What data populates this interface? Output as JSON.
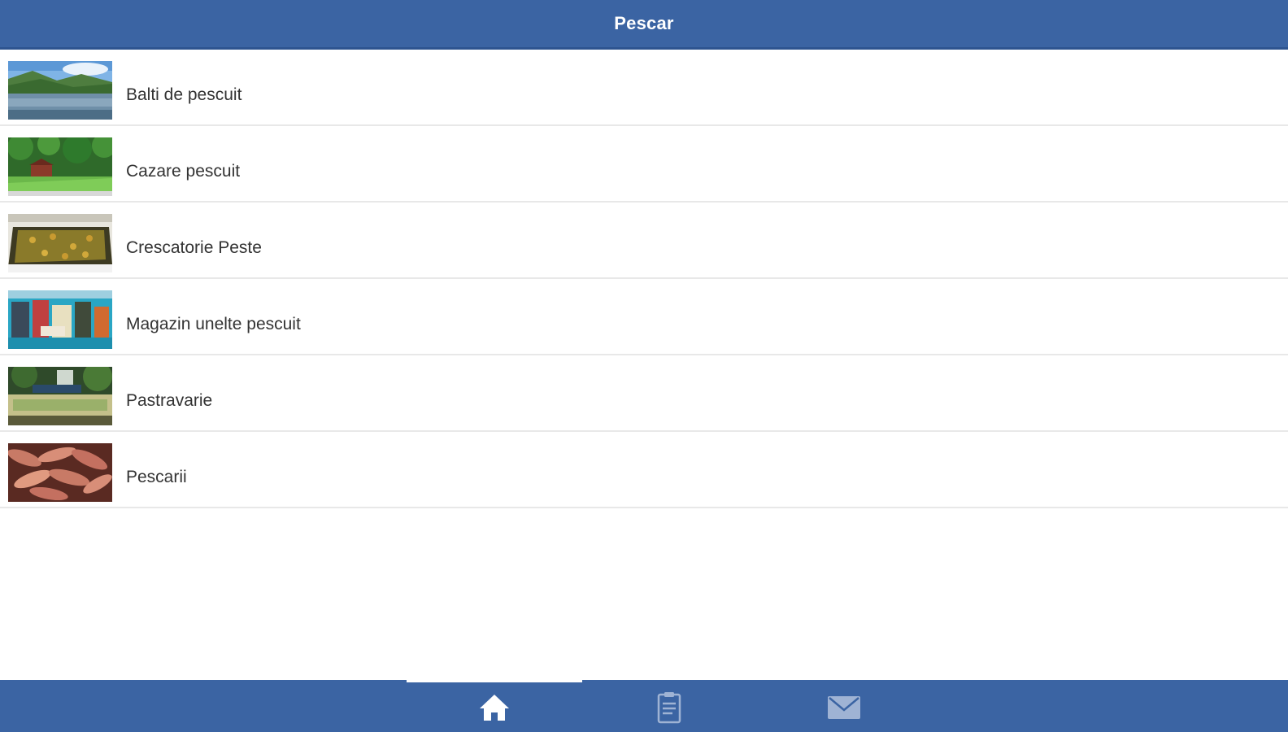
{
  "header": {
    "title": "Pescar"
  },
  "list": {
    "items": [
      {
        "label": "Balti de pescuit",
        "icon": "lake-photo"
      },
      {
        "label": "Cazare pescuit",
        "icon": "forest-cabin-photo"
      },
      {
        "label": "Crescatorie Peste",
        "icon": "fish-pond-photo"
      },
      {
        "label": "Magazin unelte pescuit",
        "icon": "tackle-shop-photo"
      },
      {
        "label": "Pastravarie",
        "icon": "trout-farm-photo"
      },
      {
        "label": "Pescarii",
        "icon": "fish-catch-photo"
      }
    ]
  },
  "tabbar": {
    "tabs": [
      {
        "icon": "home-icon",
        "active": true
      },
      {
        "icon": "notes-icon",
        "active": false
      },
      {
        "icon": "mail-icon",
        "active": false
      }
    ]
  },
  "colors": {
    "primary": "#3b64a3",
    "text": "#333333",
    "divider": "#e8e8e8"
  }
}
